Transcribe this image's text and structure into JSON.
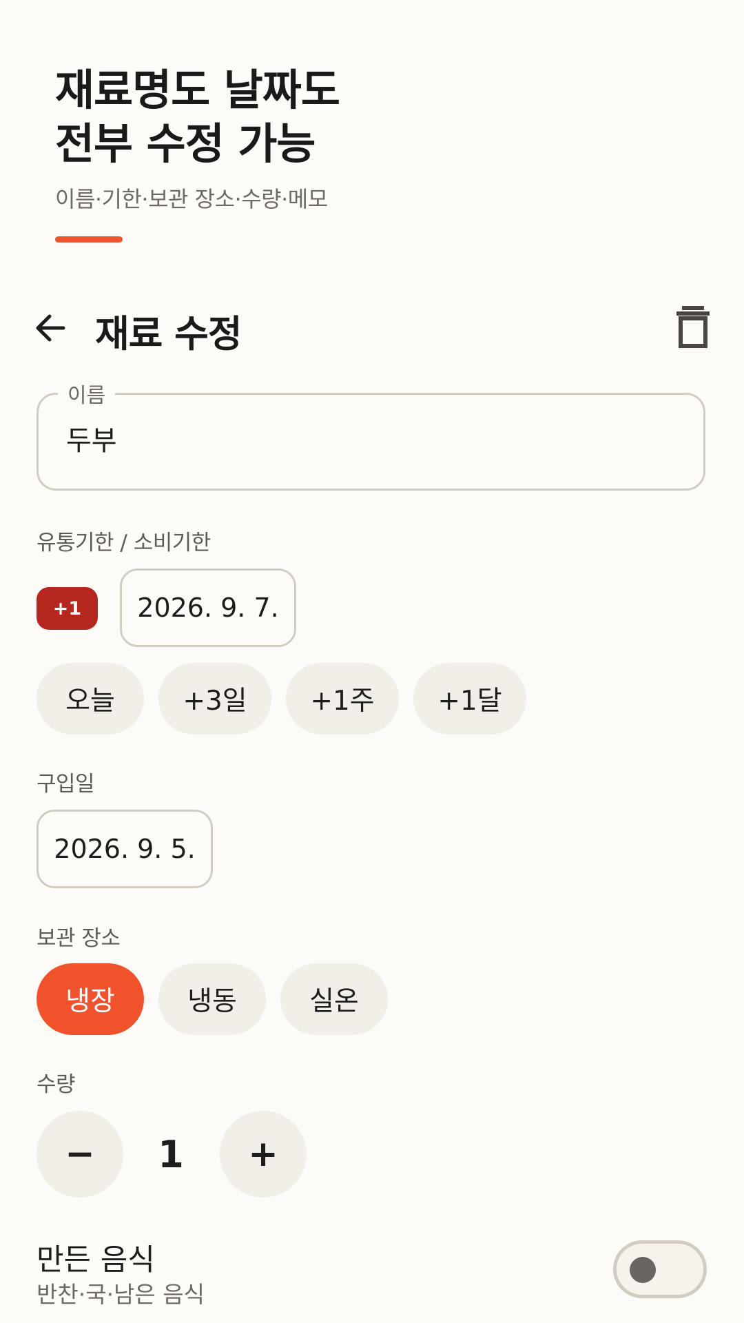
{
  "promo": {
    "title_line1": "재료명도 날짜도",
    "title_line2": "전부 수정 가능",
    "subtitle": "이름·기한·보관 장소·수량·메모"
  },
  "appbar": {
    "title": "재료 수정",
    "back_icon": "arrow-left-icon",
    "delete_icon": "trash-icon"
  },
  "name_field": {
    "label": "이름",
    "value": "두부"
  },
  "expiry": {
    "label": "유통기한 / 소비기한",
    "dday_badge": "+1",
    "date": "2026. 9. 7.",
    "quick_chips": [
      "오늘",
      "+3일",
      "+1주",
      "+1달"
    ]
  },
  "purchase": {
    "label": "구입일",
    "date": "2026. 9. 5."
  },
  "storage": {
    "label": "보관 장소",
    "options": [
      "냉장",
      "냉동",
      "실온"
    ],
    "selected": "냉장"
  },
  "quantity": {
    "label": "수량",
    "minus_label": "−",
    "value": "1",
    "plus_label": "+"
  },
  "homemade": {
    "title": "만든 음식",
    "subtitle": "반찬·국·남은 음식",
    "enabled": false
  },
  "colors": {
    "accent": "#f0522c",
    "badge_red": "#b5261f",
    "background": "#fdfbf7",
    "chip_bg": "#f2eee8",
    "border": "#d3ccc2"
  }
}
